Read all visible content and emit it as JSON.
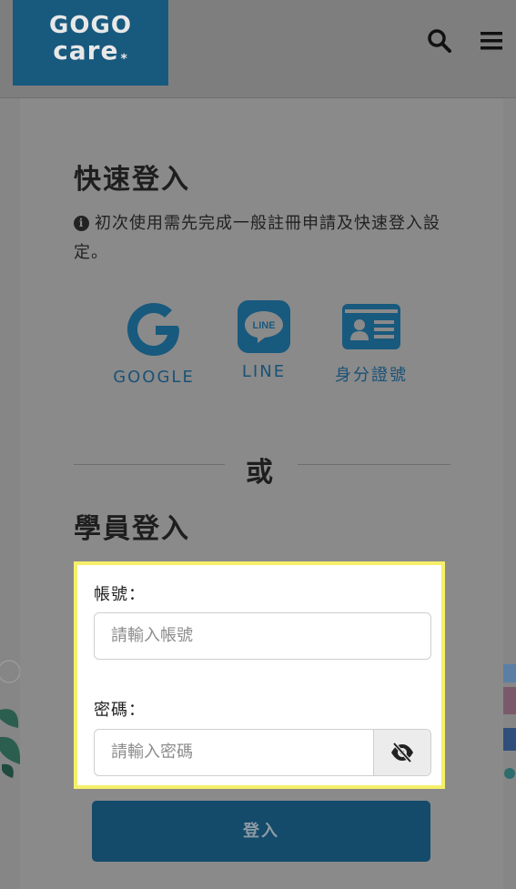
{
  "header": {
    "logo_line1": "GOGO",
    "logo_line2": "care",
    "logo_mark": "*",
    "search_icon": "search-icon",
    "menu_icon": "hamburger-menu-icon"
  },
  "quick_login": {
    "title": "快速登入",
    "notice": "初次使用需先完成一般註冊申請及快速登入設定。",
    "notice_icon": "info-circle-icon",
    "options": [
      {
        "label": "GOOGLE",
        "icon": "google-icon"
      },
      {
        "label": "LINE",
        "icon": "line-icon",
        "icon_text": "LINE"
      },
      {
        "label": "身分證號",
        "icon": "id-card-icon"
      }
    ]
  },
  "divider_text": "或",
  "member_login": {
    "title": "學員登入",
    "account_label": "帳號：",
    "account_placeholder": "請輸入帳號",
    "password_label": "密碼：",
    "password_placeholder": "請輸入密碼",
    "toggle_icon": "eye-slash-icon",
    "submit_label": "登入"
  },
  "colors": {
    "brand": "#18597e",
    "highlight": "#f5ef6a",
    "button": "#144a6a"
  }
}
